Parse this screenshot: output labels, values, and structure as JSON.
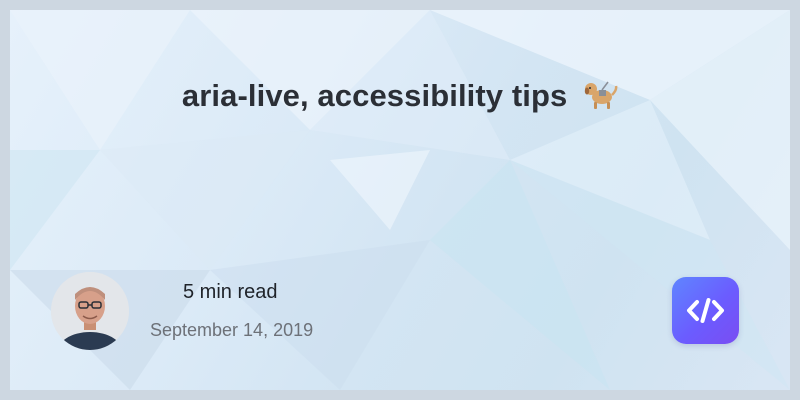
{
  "post": {
    "title": "aria-live, accessibility tips",
    "title_emoji": "guide-dog-emoji",
    "read_time": "5 min read",
    "date": "September 14, 2019"
  },
  "author": {
    "avatar": "author-avatar"
  },
  "brand": {
    "logo": "code-brackets-icon",
    "accent": "#6b5cff"
  }
}
